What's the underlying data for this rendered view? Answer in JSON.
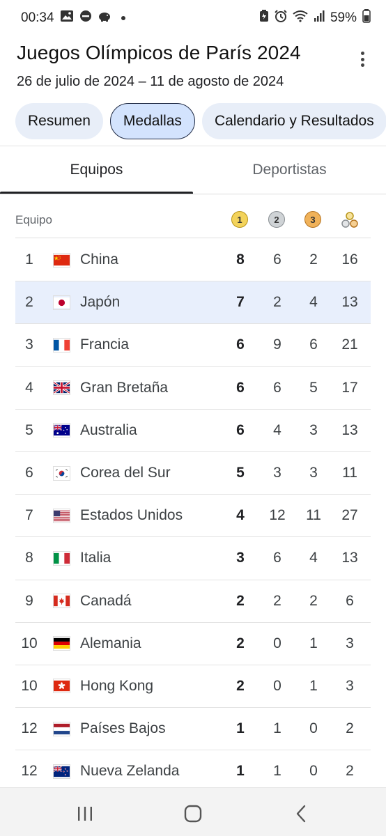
{
  "status_bar": {
    "time": "00:34",
    "battery": "59%"
  },
  "header": {
    "title": "Juegos Olímpicos de París 2024",
    "subtitle": "26 de julio de 2024 – 11 de agosto de 2024"
  },
  "chips": [
    {
      "label": "Resumen",
      "active": false
    },
    {
      "label": "Medallas",
      "active": true
    },
    {
      "label": "Calendario y Resultados",
      "active": false
    }
  ],
  "tabs": [
    {
      "label": "Equipos",
      "active": true
    },
    {
      "label": "Deportistas",
      "active": false
    }
  ],
  "table": {
    "header_team": "Equipo",
    "medal_icons": [
      "gold-medal-icon",
      "silver-medal-icon",
      "bronze-medal-icon",
      "total-medals-icon"
    ],
    "medal_numbers": [
      "1",
      "2",
      "3"
    ],
    "rows": [
      {
        "rank": "1",
        "country": "China",
        "flag": "cn",
        "gold": "8",
        "silver": "6",
        "bronze": "2",
        "total": "16",
        "highlight": false
      },
      {
        "rank": "2",
        "country": "Japón",
        "flag": "jp",
        "gold": "7",
        "silver": "2",
        "bronze": "4",
        "total": "13",
        "highlight": true
      },
      {
        "rank": "3",
        "country": "Francia",
        "flag": "fr",
        "gold": "6",
        "silver": "9",
        "bronze": "6",
        "total": "21",
        "highlight": false
      },
      {
        "rank": "4",
        "country": "Gran Bretaña",
        "flag": "gb",
        "gold": "6",
        "silver": "6",
        "bronze": "5",
        "total": "17",
        "highlight": false
      },
      {
        "rank": "5",
        "country": "Australia",
        "flag": "au",
        "gold": "6",
        "silver": "4",
        "bronze": "3",
        "total": "13",
        "highlight": false
      },
      {
        "rank": "6",
        "country": "Corea del Sur",
        "flag": "kr",
        "gold": "5",
        "silver": "3",
        "bronze": "3",
        "total": "11",
        "highlight": false
      },
      {
        "rank": "7",
        "country": "Estados Unidos",
        "flag": "us",
        "gold": "4",
        "silver": "12",
        "bronze": "11",
        "total": "27",
        "highlight": false
      },
      {
        "rank": "8",
        "country": "Italia",
        "flag": "it",
        "gold": "3",
        "silver": "6",
        "bronze": "4",
        "total": "13",
        "highlight": false
      },
      {
        "rank": "9",
        "country": "Canadá",
        "flag": "ca",
        "gold": "2",
        "silver": "2",
        "bronze": "2",
        "total": "6",
        "highlight": false
      },
      {
        "rank": "10",
        "country": "Alemania",
        "flag": "de",
        "gold": "2",
        "silver": "0",
        "bronze": "1",
        "total": "3",
        "highlight": false
      },
      {
        "rank": "10",
        "country": "Hong Kong",
        "flag": "hk",
        "gold": "2",
        "silver": "0",
        "bronze": "1",
        "total": "3",
        "highlight": false
      },
      {
        "rank": "12",
        "country": "Países Bajos",
        "flag": "nl",
        "gold": "1",
        "silver": "1",
        "bronze": "0",
        "total": "2",
        "highlight": false
      },
      {
        "rank": "12",
        "country": "Nueva Zelanda",
        "flag": "nz",
        "gold": "1",
        "silver": "1",
        "bronze": "0",
        "total": "2",
        "highlight": false
      }
    ]
  },
  "nav_bar": {
    "icons": [
      "recent-apps-icon",
      "home-icon",
      "back-icon"
    ]
  }
}
